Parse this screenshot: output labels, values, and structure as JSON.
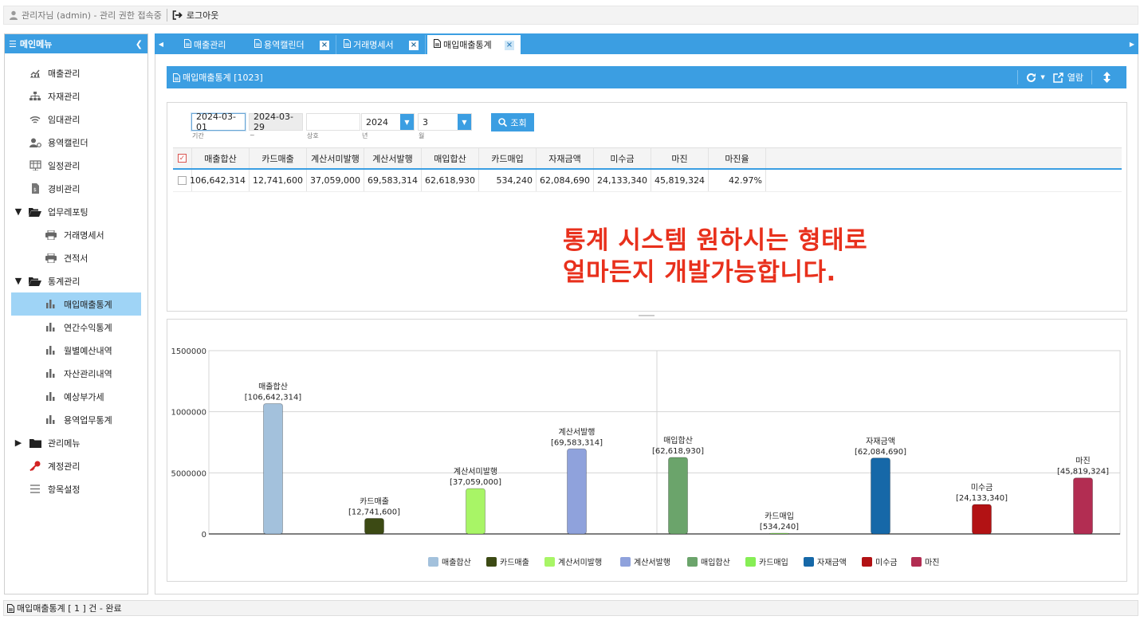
{
  "topbar": {
    "user_text": "관리자님 (admin) - 관리 권한 접속중",
    "logout_label": "로그아웃"
  },
  "sidebar": {
    "title": "메인메뉴",
    "items": [
      {
        "label": "매출관리",
        "icon": "chart-line-icon"
      },
      {
        "label": "자재관리",
        "icon": "sitemap-icon"
      },
      {
        "label": "임대관리",
        "icon": "wifi-icon"
      },
      {
        "label": "용역캘린더",
        "icon": "user-settings-icon"
      },
      {
        "label": "일정관리",
        "icon": "calendar-icon"
      },
      {
        "label": "경비관리",
        "icon": "file-icon"
      },
      {
        "label": "업무레포팅",
        "icon": "folder-open-icon"
      },
      {
        "label": "거래명세서",
        "icon": "print-icon"
      },
      {
        "label": "견적서",
        "icon": "print-icon"
      },
      {
        "label": "통계관리",
        "icon": "folder-open-icon"
      },
      {
        "label": "매입매출통계",
        "icon": "bar-chart-icon"
      },
      {
        "label": "연간수익통계",
        "icon": "bar-chart-icon"
      },
      {
        "label": "월별예산내역",
        "icon": "bar-chart-icon"
      },
      {
        "label": "자산관리내역",
        "icon": "bar-chart-icon"
      },
      {
        "label": "예상부가세",
        "icon": "bar-chart-icon"
      },
      {
        "label": "용역업무통계",
        "icon": "bar-chart-icon"
      },
      {
        "label": "관리메뉴",
        "icon": "folder-icon"
      },
      {
        "label": "계정관리",
        "icon": "key-icon"
      },
      {
        "label": "항목설정",
        "icon": "list-icon"
      }
    ]
  },
  "tabs": [
    {
      "label": "매출관리"
    },
    {
      "label": "용역캘린더"
    },
    {
      "label": "거래명세서"
    },
    {
      "label": "매입매출통계"
    }
  ],
  "panel": {
    "title": "매입매출통계 [1023]",
    "open_label": "열람"
  },
  "filters": {
    "start_date": "2024-03-01",
    "end_date": "2024-03-29",
    "customer": "",
    "year": "2024",
    "month": "3",
    "label_period": "기간",
    "label_tilde": "~",
    "label_customer": "상호",
    "label_year": "년",
    "label_month": "월",
    "search_label": "조회"
  },
  "grid": {
    "columns": [
      "매출합산",
      "카드매출",
      "계산서미발행",
      "계산서발행",
      "매입합산",
      "카드매입",
      "자재금액",
      "미수금",
      "마진",
      "마진율"
    ],
    "rows": [
      [
        "106,642,314",
        "12,741,600",
        "37,059,000",
        "69,583,314",
        "62,618,930",
        "534,240",
        "62,084,690",
        "24,133,340",
        "45,819,324",
        "42.97%"
      ]
    ]
  },
  "overlay": {
    "line1": "통계 시스템 원하시는 형태로",
    "line2": "얼마든지 개발가능합니다."
  },
  "chart_data": {
    "type": "bar",
    "categories": [
      "매출합산",
      "카드매출",
      "계산서미발행",
      "계산서발행",
      "매입합산",
      "카드매입",
      "자재금액",
      "미수금",
      "마진"
    ],
    "values": [
      106642314,
      12741600,
      37059000,
      69583314,
      62618930,
      534240,
      62084690,
      24133340,
      45819324
    ],
    "point_labels": [
      "[106,642,314]",
      "[12,741,600]",
      "[37,059,000]",
      "[69,583,314]",
      "[62,618,930]",
      "[534,240]",
      "[62,084,690]",
      "[24,133,340]",
      "[45,819,324]"
    ],
    "colors": [
      "#a3c1dc",
      "#3c4a14",
      "#a8f566",
      "#8fa2dc",
      "#6ba46b",
      "#86ee55",
      "#1668a8",
      "#b21214",
      "#b22d52"
    ],
    "yticks": [
      "0",
      "5000000",
      "1000000",
      "1500000"
    ],
    "ylim": [
      0,
      150000000
    ],
    "legend": "bottom",
    "grid": true
  },
  "status": {
    "text": "매입매출통계 [ 1 ] 건 - 완료"
  }
}
